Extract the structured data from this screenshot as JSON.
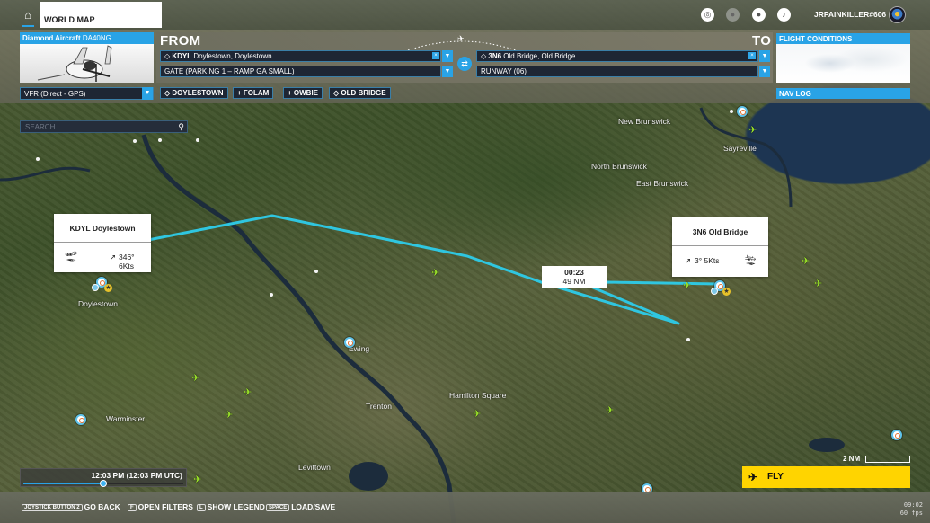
{
  "topbar": {
    "home_icon": "home-icon",
    "tab_label": "WORLD MAP",
    "icons": [
      "activity-icon",
      "friends-icon",
      "profile-icon",
      "notifications-icon"
    ],
    "username": "JRPAINKILLER#606"
  },
  "aircraft": {
    "maker": "Diamond Aircraft",
    "model": "DA40NG"
  },
  "route": {
    "from_label": "FROM",
    "to_label": "TO",
    "departure": {
      "code": "KDYL",
      "name": "Doylestown, Doylestown"
    },
    "departure_spot": "GATE (PARKING 1 – RAMP GA SMALL)",
    "arrival": {
      "code": "3N6",
      "name": "Old Bridge, Old Bridge"
    },
    "arrival_spot": "RUNWAY (06)",
    "swap_icon": "swap-icon"
  },
  "flight_type": "VFR (Direct - GPS)",
  "waypoints": [
    {
      "symbol": "◇",
      "label": "DOYLESTOWN"
    },
    {
      "symbol": "+",
      "label": "FOLAM"
    },
    {
      "symbol": "+",
      "label": "OWBIE"
    },
    {
      "symbol": "◇",
      "label": "OLD BRIDGE"
    }
  ],
  "panels": {
    "flight_conditions": "FLIGHT CONDITIONS",
    "nav_log": "NAV LOG"
  },
  "search": {
    "placeholder": "SEARCH",
    "value": ""
  },
  "popups": {
    "departure": {
      "title": "KDYL Doylestown",
      "wind": "346° 6Kts"
    },
    "arrival": {
      "title": "3N6 Old Bridge",
      "wind": "3° 5Kts"
    }
  },
  "leg": {
    "time": "00:23",
    "distance": "49 NM"
  },
  "map_labels": [
    "New Brunswick",
    "Sayreville",
    "North Brunswick",
    "East Brunswick",
    "Doylestown",
    "Ewing",
    "Hamilton Square",
    "Trenton",
    "Warminster",
    "Levittown"
  ],
  "time_of_day": {
    "label": "12:03 PM (12:03 PM UTC)",
    "slider_fraction": 0.5
  },
  "scale": "2 NM",
  "fly_button": "FLY",
  "hints": [
    {
      "key": "JOYSTICK BUTTON 2",
      "label": "GO BACK"
    },
    {
      "key": "F",
      "label": "OPEN FILTERS"
    },
    {
      "key": "L",
      "label": "SHOW LEGEND"
    },
    {
      "key": "SPACE",
      "label": "LOAD/SAVE"
    }
  ],
  "status": {
    "clock": "09:02",
    "fps": "60 fps"
  },
  "colors": {
    "accent": "#29a3e6",
    "route": "#2fc6e0",
    "fly": "#ffd400",
    "poi_plane": "#9ae22a"
  }
}
